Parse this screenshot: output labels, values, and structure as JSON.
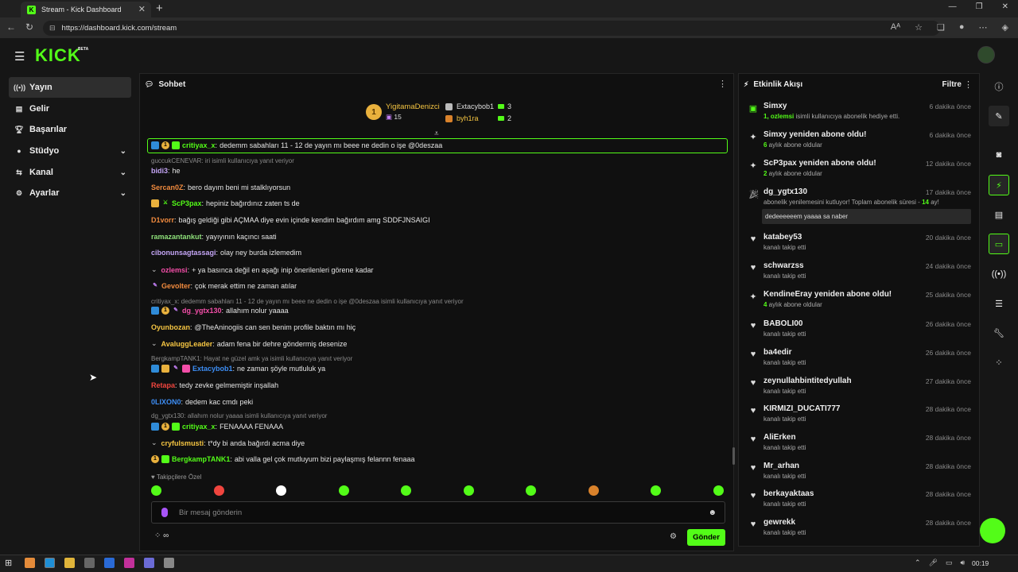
{
  "browser": {
    "tab_title": "Stream - Kick Dashboard",
    "url": "https://dashboard.kick.com/stream"
  },
  "app": {
    "logo": "KICK",
    "beta": "BETA"
  },
  "sidebar": {
    "items": [
      {
        "label": "Yayın",
        "icon": "broadcast-icon"
      },
      {
        "label": "Gelir",
        "icon": "revenue-icon"
      },
      {
        "label": "Başarılar",
        "icon": "trophy-icon"
      },
      {
        "label": "Stüdyo",
        "icon": "studio-icon"
      },
      {
        "label": "Kanal",
        "icon": "channel-icon"
      },
      {
        "label": "Ayarlar",
        "icon": "gear-icon"
      }
    ]
  },
  "chat": {
    "title": "Sohbet",
    "leaderboard": {
      "first": {
        "rank": "1",
        "name": "YigitamaDenizci",
        "value": "15"
      },
      "second": {
        "name": "Extacybob1",
        "value": "3"
      },
      "third": {
        "name": "byh1ra",
        "value": "2"
      }
    },
    "messages": [
      {
        "user": "critiyax_x",
        "color": "#53fc18",
        "text": "dedemm sabahları 11 - 12 de yayın mı beee ne dedin o işe @0deszaa"
      },
      {
        "reply": "guccukCENEVAR: iri isimli kullanıcıya yanıt veriyor"
      },
      {
        "user": "bidi3",
        "color": "#c4a5f5",
        "text": "he"
      },
      {
        "user": "Sercan0Z",
        "color": "#f08a3e",
        "text": "bero dayım beni mi stalklıyorsun"
      },
      {
        "user": "ScP3pax",
        "color": "#53fc18",
        "text": "hepiniz bağırdınız zaten ts de"
      },
      {
        "user": "D1vorr",
        "color": "#f08a3e",
        "text": "bağış geldiği gibi AÇMAA diye evin içinde kendim bağırdım amg SDDFJNSAIGI"
      },
      {
        "user": "ramazantankut",
        "color": "#8ee07a",
        "text": "yayıyının kaçıncı saati"
      },
      {
        "user": "cibonunsagtassagi",
        "color": "#c4a5f5",
        "text": "olay ney burda izlemedim"
      },
      {
        "user": "ozlemsi",
        "color": "#f34ea8",
        "text": "+ ya basınca değil en aşağı inip önerilenleri görene kadar"
      },
      {
        "user": "Gevolter",
        "color": "#f08a3e",
        "text": "çok merak ettim ne zaman atılar"
      },
      {
        "reply": "critiyax_x: dedemm sabahları 11 - 12 de yayın mı beee ne dedin o işe @0deszaa isimli kullanıcıya yanıt veriyor"
      },
      {
        "user": "dg_ygtx130",
        "color": "#f34ea8",
        "text": "allahım nolur yaaaa"
      },
      {
        "user": "Oyunbozan",
        "color": "#f5c542",
        "text": "@TheAninogiis can sen benim profile baktın mı hiç"
      },
      {
        "user": "AvaluggLeader",
        "color": "#f5c542",
        "text": "adam fena bir dehre göndermiş desenize"
      },
      {
        "reply": "BergkampTANK1: Hayat ne güzel amk ya isimli kullanıcıya yanıt veriyor"
      },
      {
        "user": "Extacybob1",
        "color": "#3d8ef5",
        "text": "ne zaman şöyle mutluluk ya"
      },
      {
        "user": "Retapa",
        "color": "#f0453e",
        "text": "tedy zevke gelmemiştir inşallah"
      },
      {
        "user": "0LIXON0",
        "color": "#3d8ef5",
        "text": "dedem kac cmdı peki"
      },
      {
        "reply": "dg_ygtx130: allahım nolur yaaaa isimli kullanıcıya yanıt veriyor"
      },
      {
        "user": "critiyax_x",
        "color": "#53fc18",
        "text": "FENAAAA FENAAA"
      },
      {
        "user": "cryfulsmusti",
        "color": "#f5c542",
        "text": "t*dy bi anda bağırdı acma diye"
      },
      {
        "user": "BergkampTANK1",
        "color": "#53fc18",
        "text": "abi valla gel çok mutluyum bizi paylaşmış felannn fenaaa"
      }
    ],
    "emote_label": "Takipçilere Özel",
    "input_placeholder": "Bir mesaj gönderin",
    "send": "Gönder",
    "footer_icon": "infinity-icon"
  },
  "activity": {
    "title": "Etkinlik Akışı",
    "filter": "Filtre",
    "events": [
      {
        "name": "Simxy",
        "time": "6 dakika önce",
        "desc_a": "1, ozlemsi",
        "desc_b": " isimli kullanıcıya abonelik hediye etti.",
        "icon": "gift-icon"
      },
      {
        "name": "Simxy yeniden abone oldu!",
        "time": "6 dakika önce",
        "desc_a": "6",
        "desc_b": " aylık abone oldular",
        "icon": "star-icon"
      },
      {
        "name": "ScP3pax yeniden abone oldu!",
        "time": "12 dakika önce",
        "desc_a": "2",
        "desc_b": " aylık abone oldular",
        "icon": "star-icon"
      },
      {
        "name": "dg_ygtx130",
        "time": "17 dakika önce",
        "desc_a": "",
        "desc_b": "abonelik yenilemesini kutluyor! Toplam abonelik süresi - ",
        "desc_c": "14",
        "desc_d": " ay!",
        "quote": "dedeeeeeem yaaaa sa naber",
        "icon": "party-icon"
      },
      {
        "name": "katabey53",
        "time": "20 dakika önce",
        "desc_b": "kanalı takip etti",
        "icon": "heart-icon"
      },
      {
        "name": "schwarzss",
        "time": "24 dakika önce",
        "desc_b": "kanalı takip etti",
        "icon": "heart-icon"
      },
      {
        "name": "KendineEray yeniden abone oldu!",
        "time": "25 dakika önce",
        "desc_a": "4",
        "desc_b": " aylık abone oldular",
        "icon": "star-icon"
      },
      {
        "name": "BABOLI00",
        "time": "26 dakika önce",
        "desc_b": "kanalı takip etti",
        "icon": "heart-icon"
      },
      {
        "name": "ba4edir",
        "time": "26 dakika önce",
        "desc_b": "kanalı takip etti",
        "icon": "heart-icon"
      },
      {
        "name": "zeynullahbintitedyullah",
        "time": "27 dakika önce",
        "desc_b": "kanalı takip etti",
        "icon": "heart-icon"
      },
      {
        "name": "KIRMIZI_DUCATI777",
        "time": "28 dakika önce",
        "desc_b": "kanalı takip etti",
        "icon": "heart-icon"
      },
      {
        "name": "AliErken",
        "time": "28 dakika önce",
        "desc_b": "kanalı takip etti",
        "icon": "heart-icon"
      },
      {
        "name": "Mr_arhan",
        "time": "28 dakika önce",
        "desc_b": "kanalı takip etti",
        "icon": "heart-icon"
      },
      {
        "name": "berkayaktaas",
        "time": "28 dakika önce",
        "desc_b": "kanalı takip etti",
        "icon": "heart-icon"
      },
      {
        "name": "gewrekk",
        "time": "28 dakika önce",
        "desc_b": "kanalı takip etti",
        "icon": "heart-icon"
      }
    ]
  },
  "taskbar": {
    "clock": "00:19"
  },
  "colors": {
    "accent": "#53fc18"
  }
}
